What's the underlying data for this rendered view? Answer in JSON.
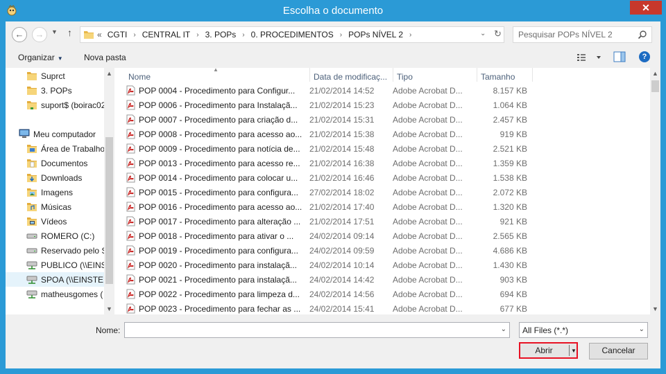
{
  "window": {
    "title": "Escolha o documento",
    "close_glyph": "✕"
  },
  "address": {
    "overflow": "«",
    "crumbs": [
      "CGTI",
      "CENTRAL IT",
      "3. POPs",
      "0. PROCEDIMENTOS",
      "POPs NÍVEL 2"
    ]
  },
  "search": {
    "placeholder": "Pesquisar POPs NÍVEL 2"
  },
  "toolbar": {
    "organize_label": "Organizar",
    "new_folder_label": "Nova pasta"
  },
  "nav": {
    "items": [
      {
        "label": "Suprct",
        "icon": "folder-icon",
        "indent": 1
      },
      {
        "label": "3. POPs",
        "icon": "folder-icon",
        "indent": 1
      },
      {
        "label": "suport$ (boirac02",
        "icon": "network-folder-icon",
        "indent": 1
      },
      {
        "label": "Meu computador",
        "icon": "computer-icon",
        "indent": 0
      },
      {
        "label": "Área de Trabalho",
        "icon": "desktop-folder-icon",
        "indent": 1
      },
      {
        "label": "Documentos",
        "icon": "documents-folder-icon",
        "indent": 1
      },
      {
        "label": "Downloads",
        "icon": "downloads-folder-icon",
        "indent": 1
      },
      {
        "label": "Imagens",
        "icon": "pictures-folder-icon",
        "indent": 1
      },
      {
        "label": "Músicas",
        "icon": "music-folder-icon",
        "indent": 1
      },
      {
        "label": "Vídeos",
        "icon": "videos-folder-icon",
        "indent": 1
      },
      {
        "label": "ROMERO (C:)",
        "icon": "drive-icon",
        "indent": 1
      },
      {
        "label": "Reservado pelo S",
        "icon": "drive-icon",
        "indent": 1
      },
      {
        "label": "PUBLICO (\\\\EINS",
        "icon": "network-drive-icon",
        "indent": 1
      },
      {
        "label": "SPOA (\\\\EINSTEII",
        "icon": "network-drive-icon",
        "indent": 1,
        "selected": true
      },
      {
        "label": "matheusgomes (",
        "icon": "network-drive-icon",
        "indent": 1
      }
    ]
  },
  "columns": {
    "name": "Nome",
    "date": "Data de modificaç...",
    "type": "Tipo",
    "size": "Tamanho"
  },
  "files": [
    {
      "name": "POP 0004 - Procedimento para Configur...",
      "date": "21/02/2014 14:52",
      "type": "Adobe Acrobat D...",
      "size": "8.157 KB"
    },
    {
      "name": "POP 0006 - Procedimento para Instalaçã...",
      "date": "21/02/2014 15:23",
      "type": "Adobe Acrobat D...",
      "size": "1.064 KB"
    },
    {
      "name": "POP 0007 - Procedimento para criação d...",
      "date": "21/02/2014 15:31",
      "type": "Adobe Acrobat D...",
      "size": "2.457 KB"
    },
    {
      "name": "POP 0008 - Procedimento para acesso ao...",
      "date": "21/02/2014 15:38",
      "type": "Adobe Acrobat D...",
      "size": "919 KB"
    },
    {
      "name": "POP 0009 - Procedimento para notícia de...",
      "date": "21/02/2014 15:48",
      "type": "Adobe Acrobat D...",
      "size": "2.521 KB"
    },
    {
      "name": "POP 0013 - Procedimento para acesso re...",
      "date": "21/02/2014 16:38",
      "type": "Adobe Acrobat D...",
      "size": "1.359 KB"
    },
    {
      "name": "POP 0014 - Procedimento para colocar u...",
      "date": "21/02/2014 16:46",
      "type": "Adobe Acrobat D...",
      "size": "1.538 KB"
    },
    {
      "name": "POP 0015 - Procedimento para configura...",
      "date": "27/02/2014 18:02",
      "type": "Adobe Acrobat D...",
      "size": "2.072 KB"
    },
    {
      "name": "POP 0016 - Procedimento para acesso ao...",
      "date": "21/02/2014 17:40",
      "type": "Adobe Acrobat D...",
      "size": "1.320 KB"
    },
    {
      "name": "POP 0017 - Procedimento para alteração ...",
      "date": "21/02/2014 17:51",
      "type": "Adobe Acrobat D...",
      "size": "921 KB"
    },
    {
      "name": "POP 0018 - Procedimento para ativar o ...",
      "date": "24/02/2014 09:14",
      "type": "Adobe Acrobat D...",
      "size": "2.565 KB"
    },
    {
      "name": "POP 0019 - Procedimento para configura...",
      "date": "24/02/2014 09:59",
      "type": "Adobe Acrobat D...",
      "size": "4.686 KB"
    },
    {
      "name": "POP 0020 - Procedimento para instalaçã...",
      "date": "24/02/2014 10:14",
      "type": "Adobe Acrobat D...",
      "size": "1.430 KB"
    },
    {
      "name": "POP 0021 - Procedimento para instalaçã...",
      "date": "24/02/2014 14:42",
      "type": "Adobe Acrobat D...",
      "size": "903 KB"
    },
    {
      "name": "POP 0022 - Procedimento para limpeza d...",
      "date": "24/02/2014 14:56",
      "type": "Adobe Acrobat D...",
      "size": "694 KB"
    },
    {
      "name": "POP 0023 - Procedimento para fechar as ...",
      "date": "24/02/2014 15:41",
      "type": "Adobe Acrobat D...",
      "size": "677 KB"
    }
  ],
  "footer": {
    "name_label": "Nome:",
    "name_value": "",
    "filter": "All Files (*.*)",
    "open_label": "Abrir",
    "cancel_label": "Cancelar"
  },
  "colors": {
    "frame": "#2b9ad6",
    "close": "#c7382c",
    "highlight_border": "#e81123",
    "pdf_red": "#c8201e"
  }
}
